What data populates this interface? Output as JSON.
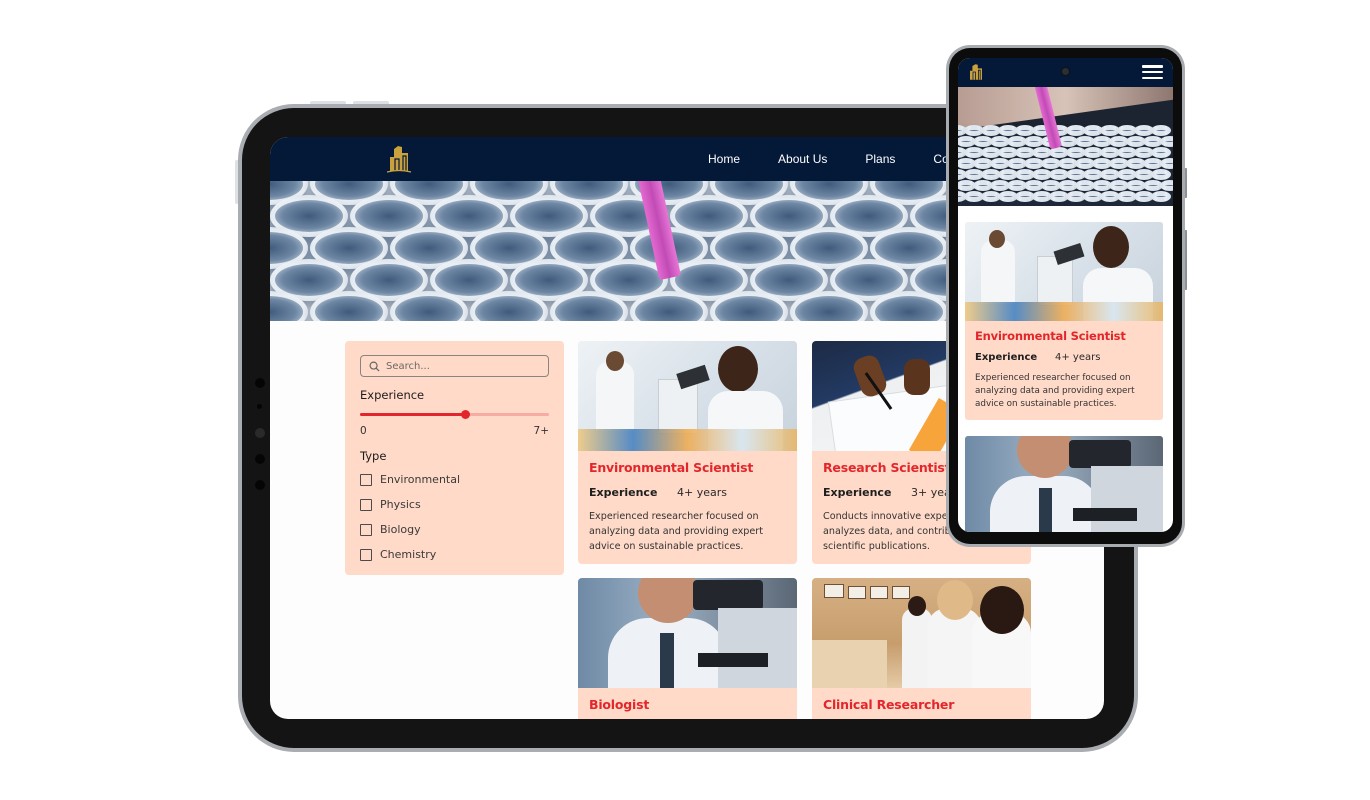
{
  "tablet": {
    "nav": {
      "logo": "building-logo",
      "links": [
        "Home",
        "About Us",
        "Plans",
        "Co"
      ]
    },
    "hero": {
      "image": "test-tubes-with-pink-pipette"
    },
    "filter": {
      "search_placeholder": "Search...",
      "experience_label": "Experience",
      "slider": {
        "min_label": "0",
        "max_label": "7+",
        "value_fraction": 0.56
      },
      "type_label": "Type",
      "types": [
        {
          "label": "Environmental",
          "checked": false
        },
        {
          "label": "Physics",
          "checked": false
        },
        {
          "label": "Biology",
          "checked": false
        },
        {
          "label": "Chemistry",
          "checked": false
        }
      ]
    },
    "cards": [
      {
        "image": "scientists-with-microscope",
        "title": "Environmental Scientist",
        "experience_label": "Experience",
        "experience_value": "4+ years",
        "description": "Experienced researcher focused on analyzing data and providing expert advice on sustainable practices."
      },
      {
        "image": "hands-analyzing-charts",
        "title": "Research Scientist",
        "experience_label": "Experience",
        "experience_value": "3+ years",
        "description": "Conducts innovative experiments, analyzes data, and contributes to scientific publications."
      },
      {
        "image": "man-at-microscope",
        "title": "Biologist"
      },
      {
        "image": "clinical-staff-at-desk",
        "title": "Clinical Researcher"
      }
    ]
  },
  "phone": {
    "nav": {
      "logo": "building-logo",
      "menu": "hamburger-menu"
    },
    "hero": {
      "image": "test-tube-rack-with-pink-pipette"
    },
    "cards": [
      {
        "image": "scientists-with-microscope",
        "title": "Environmental Scientist",
        "experience_label": "Experience",
        "experience_value": "4+ years",
        "description": "Experienced researcher focused on analyzing data and providing expert advice on sustainable practices."
      },
      {
        "image": "man-at-microscope"
      }
    ]
  },
  "colors": {
    "nav_bg": "#041838",
    "logo_gold": "#c9a13f",
    "card_bg": "#ffdac8",
    "accent_red": "#e3262b",
    "slider_track": "#f6aca2"
  }
}
